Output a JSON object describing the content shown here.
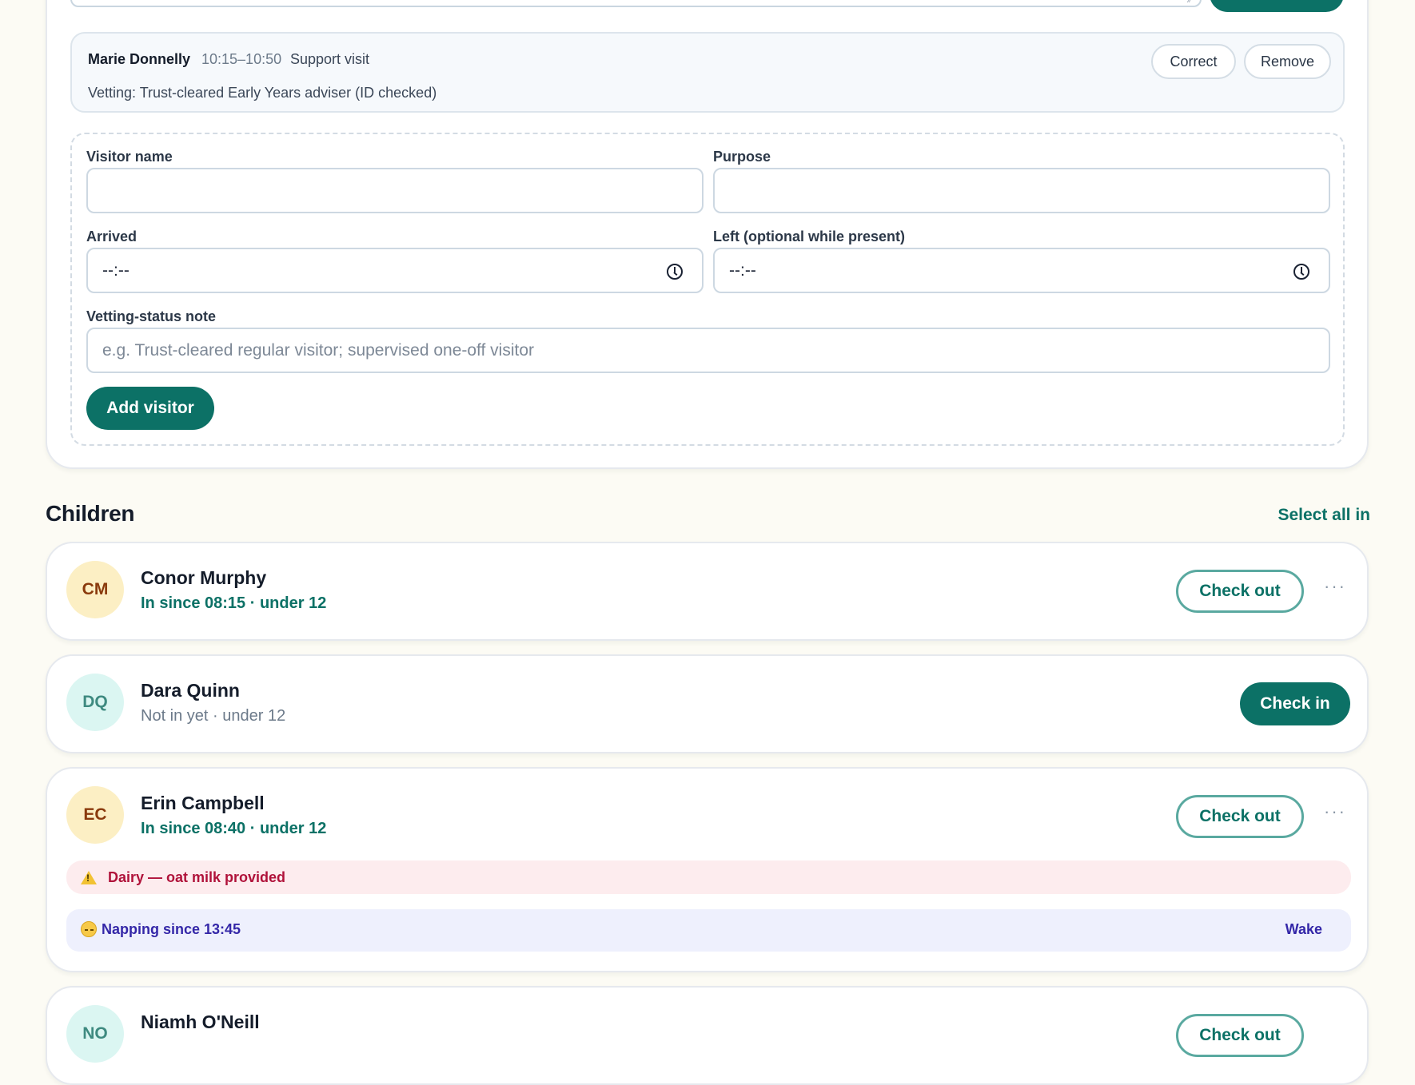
{
  "visitors": {
    "entry": {
      "name": "Marie Donnelly",
      "time": "10:15–10:50",
      "purpose": "Support visit",
      "vetting": "Vetting: Trust-cleared Early Years adviser (ID checked)",
      "correct_label": "Correct",
      "remove_label": "Remove"
    },
    "form": {
      "name_label": "Visitor name",
      "name_value": "",
      "purpose_label": "Purpose",
      "purpose_value": "",
      "arrived_label": "Arrived",
      "arrived_value": "--:--",
      "left_label": "Left (optional while present)",
      "left_value": "--:--",
      "vetting_label": "Vetting-status note",
      "vetting_placeholder": "e.g. Trust-cleared regular visitor; supervised one-off visitor",
      "submit_label": "Add visitor"
    }
  },
  "children": {
    "title": "Children",
    "select_all_label": "Select all in",
    "items": [
      {
        "initials": "CM",
        "name": "Conor Murphy",
        "status": "In since 08:15 · under 12",
        "action_label": "Check out"
      },
      {
        "initials": "DQ",
        "name": "Dara Quinn",
        "status": "Not in yet · under 12",
        "action_label": "Check in"
      },
      {
        "initials": "EC",
        "name": "Erin Campbell",
        "status": "In since 08:40 · under 12",
        "action_label": "Check out",
        "allergy": "Dairy — oat milk provided",
        "nap": "Napping since 13:45",
        "wake_label": "Wake"
      },
      {
        "initials": "NO",
        "name": "Niamh O'Neill",
        "status": "",
        "action_label": "Check out"
      }
    ]
  },
  "colors": {
    "accent": "#0c7166",
    "allergy": "#b0123a",
    "nap": "#3427a8",
    "page_background": "#fcfbf4"
  },
  "icons": [
    "clock-icon",
    "more-icon",
    "warning-icon",
    "sleep-icon",
    "resize-grip-icon"
  ]
}
